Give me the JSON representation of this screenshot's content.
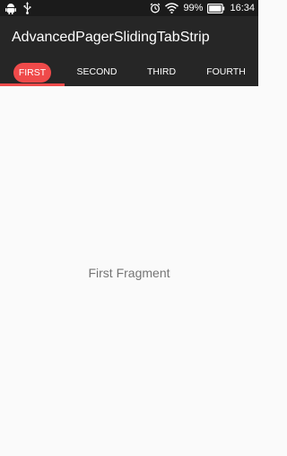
{
  "status_bar": {
    "battery": "99%",
    "time": "16:34",
    "icons": [
      "android-debug-icon",
      "usb-icon",
      "alarm-icon",
      "wifi-icon",
      "battery-icon"
    ]
  },
  "app_bar": {
    "title": "AdvancedPagerSlidingTabStrip"
  },
  "tabs": [
    {
      "label": "FIRST",
      "selected": true
    },
    {
      "label": "SECOND",
      "selected": false
    },
    {
      "label": "THIRD",
      "selected": false
    },
    {
      "label": "FOURTH",
      "selected": false
    }
  ],
  "content": {
    "text": "First Fragment"
  },
  "colors": {
    "accent": "#ef4a4a",
    "toolbar": "#262626",
    "status_bar": "#1b1b1b",
    "background": "#fafafa"
  }
}
